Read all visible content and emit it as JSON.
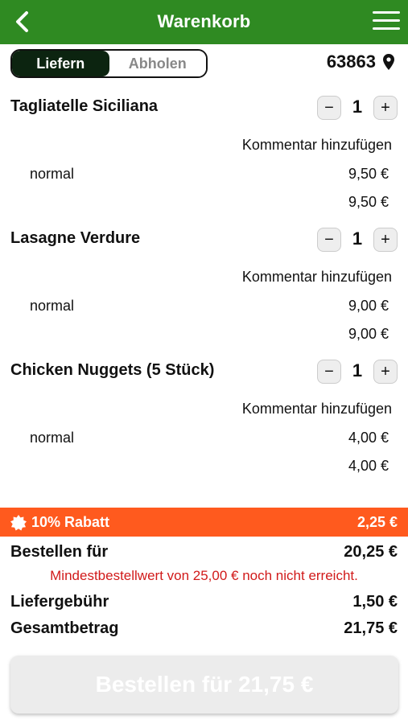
{
  "header": {
    "title": "Warenkorb",
    "back_icon": "chevron-left-icon",
    "menu_icon": "hamburger-menu-icon"
  },
  "delivery_toggle": {
    "options": [
      "Liefern",
      "Abholen"
    ],
    "selected": "Liefern"
  },
  "location": {
    "zip": "63863",
    "icon": "map-pin-icon"
  },
  "items": [
    {
      "name": "Tagliatelle Siciliana",
      "quantity": "1",
      "comment_label": "Kommentar hinzufügen",
      "variant": "normal",
      "variant_price": "9,50 €",
      "total": "9,50 €"
    },
    {
      "name": "Lasagne Verdure",
      "quantity": "1",
      "comment_label": "Kommentar hinzufügen",
      "variant": "normal",
      "variant_price": "9,00 €",
      "total": "9,00 €"
    },
    {
      "name": "Chicken Nuggets (5 Stück)",
      "quantity": "1",
      "comment_label": "Kommentar hinzufügen",
      "variant": "normal",
      "variant_price": "4,00 €",
      "total": "4,00 €"
    }
  ],
  "discount": {
    "label": "10% Rabatt",
    "value": "2,25 €",
    "icon": "badge-burst-icon"
  },
  "summary": {
    "order_for_label": "Bestellen für",
    "order_for_value": "20,25 €",
    "warning": "Mindestbestellwert von 25,00 € noch nicht erreicht.",
    "delivery_fee_label": "Liefergebühr",
    "delivery_fee_value": "1,50 €",
    "total_label": "Gesamtbetrag",
    "total_value": "21,75 €"
  },
  "order_button": {
    "label": "Bestellen für 21,75 €"
  },
  "colors": {
    "header_green": "#2f8a22",
    "toggle_active": "#0c2410",
    "discount_orange": "#ff5a1e",
    "warning_red": "#d11a1a",
    "button_disabled": "#ececec"
  }
}
